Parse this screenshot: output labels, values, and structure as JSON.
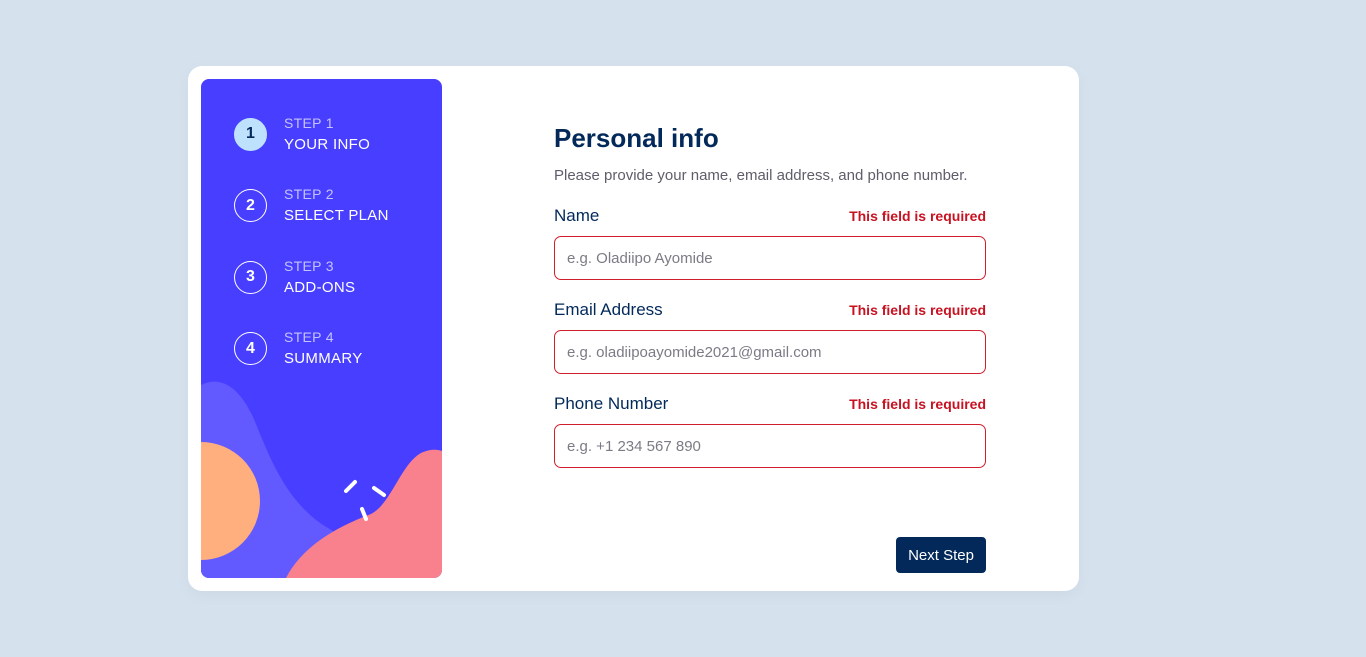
{
  "sidebar": {
    "steps": [
      {
        "number": "1",
        "label": "STEP 1",
        "title": "YOUR INFO",
        "active": true
      },
      {
        "number": "2",
        "label": "STEP 2",
        "title": "SELECT PLAN",
        "active": false
      },
      {
        "number": "3",
        "label": "STEP 3",
        "title": "ADD-ONS",
        "active": false
      },
      {
        "number": "4",
        "label": "STEP 4",
        "title": "SUMMARY",
        "active": false
      }
    ]
  },
  "form": {
    "title": "Personal info",
    "subtitle": "Please provide your name, email address, and phone number.",
    "fields": [
      {
        "label": "Name",
        "error": "This field is required",
        "value": "",
        "placeholder": "e.g. Oladiipo Ayomide"
      },
      {
        "label": "Email Address",
        "error": "This field is required",
        "value": "",
        "placeholder": "e.g. oladiipoayomide2021@gmail.com"
      },
      {
        "label": "Phone Number",
        "error": "This field is required",
        "value": "",
        "placeholder": "e.g. +1 234 567 890"
      }
    ],
    "next_label": "Next Step"
  },
  "colors": {
    "page_bg": "#d6e1ee",
    "sidebar_bg": "#483eff",
    "active_step": "#bee2fd",
    "primary": "#02295a",
    "error": "#c81221"
  }
}
